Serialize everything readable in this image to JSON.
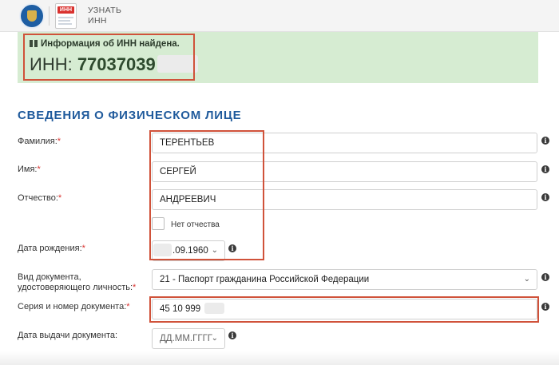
{
  "header": {
    "app_title": "УЗНАТЬ\nИНН",
    "inn_badge": "ИНН"
  },
  "banner": {
    "found_text": "Информация об ИНН найдена.",
    "inn_prefix": "ИНН: ",
    "inn_value": "77037039"
  },
  "section": {
    "title": "Сведения о физическом лице"
  },
  "form": {
    "surname": {
      "label": "Фамилия:",
      "value": "ТЕРЕНТЬЕВ"
    },
    "name": {
      "label": "Имя:",
      "value": "СЕРГЕЙ"
    },
    "patronymic": {
      "label": "Отчество:",
      "value": "АНДРЕЕВИЧ"
    },
    "no_patronymic": {
      "label": "Нет отчества",
      "checked": false
    },
    "birth_date": {
      "label": "Дата рождения:",
      "value": ".09.1960"
    },
    "doc_type": {
      "label_line1": "Вид документа,",
      "label_line2": "удостоверяющего личность:",
      "value": "21 - Паспорт гражданина Российской Федерации"
    },
    "doc_number": {
      "label": "Серия и номер документа:",
      "value": "45 10 999"
    },
    "issue_date": {
      "label": "Дата выдачи документа:",
      "placeholder": "ДД.ММ.ГГГГ"
    },
    "required_mark": "*"
  },
  "colors": {
    "section_title": "#1f5a9c",
    "banner_bg": "#d6ecd2",
    "highlight": "#d0523a",
    "required": "#d9322f"
  },
  "icons": [
    "emblem-icon",
    "inn-document-icon",
    "gift-icon",
    "info-icon",
    "chevron-down-icon"
  ]
}
